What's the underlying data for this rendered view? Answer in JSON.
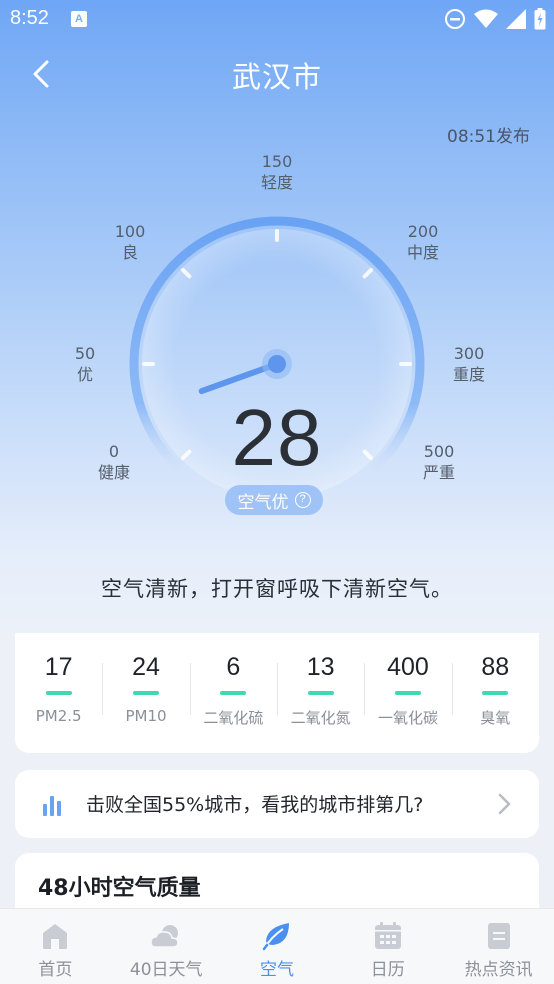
{
  "status_bar": {
    "time": "8:52",
    "app_icon_letter": "A"
  },
  "header": {
    "title": "武汉市",
    "publish_time": "08:51发布"
  },
  "gauge": {
    "aqi": "28",
    "level_label": "空气优",
    "needle_value": 28,
    "scale": [
      {
        "value": "0",
        "label": "健康"
      },
      {
        "value": "50",
        "label": "优"
      },
      {
        "value": "100",
        "label": "良"
      },
      {
        "value": "150",
        "label": "轻度"
      },
      {
        "value": "200",
        "label": "中度"
      },
      {
        "value": "300",
        "label": "重度"
      },
      {
        "value": "500",
        "label": "严重"
      }
    ]
  },
  "advice": "空气清新，打开窗呼吸下清新空气。",
  "pollutants": [
    {
      "value": "17",
      "name": "PM2.5"
    },
    {
      "value": "24",
      "name": "PM10"
    },
    {
      "value": "6",
      "name": "二氧化硫"
    },
    {
      "value": "13",
      "name": "二氧化氮"
    },
    {
      "value": "400",
      "name": "一氧化碳"
    },
    {
      "value": "88",
      "name": "臭氧"
    }
  ],
  "rank": {
    "text": "击败全国55%城市，看我的城市排第几?"
  },
  "hourly": {
    "title": "48小时空气质量"
  },
  "tabs": [
    {
      "label": "首页",
      "icon": "home-icon"
    },
    {
      "label": "40日天气",
      "icon": "cloud-icon"
    },
    {
      "label": "空气",
      "icon": "leaf-icon",
      "active": true
    },
    {
      "label": "日历",
      "icon": "calendar-icon"
    },
    {
      "label": "热点资讯",
      "icon": "news-icon"
    }
  ],
  "colors": {
    "accent": "#4a90f0",
    "gauge_arc": "#7fb0f7",
    "good_bar": "#3fd8b0",
    "tab_inactive": "#c9ccd2"
  }
}
